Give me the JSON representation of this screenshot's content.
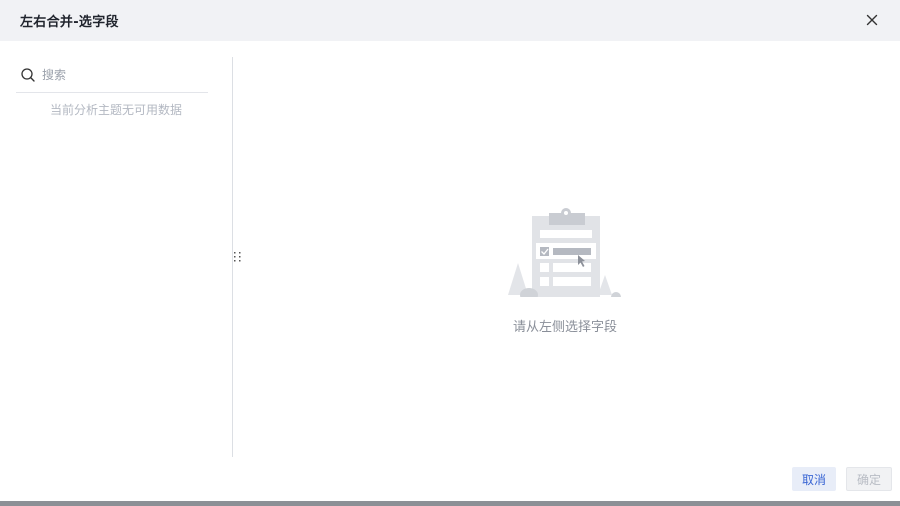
{
  "dialog": {
    "title": "左右合并-选字段"
  },
  "left_panel": {
    "search_placeholder": "搜索",
    "empty_message": "当前分析主题无可用数据"
  },
  "main": {
    "empty_message": "请从左侧选择字段"
  },
  "footer": {
    "cancel_label": "取消",
    "ok_label": "确定"
  },
  "icons": {
    "close": "close-icon",
    "search": "search-icon",
    "drag": "drag-handle-icon"
  },
  "colors": {
    "header_bg": "#f1f2f5",
    "accent": "#3a66d4",
    "muted_text": "#b3b8c2"
  }
}
